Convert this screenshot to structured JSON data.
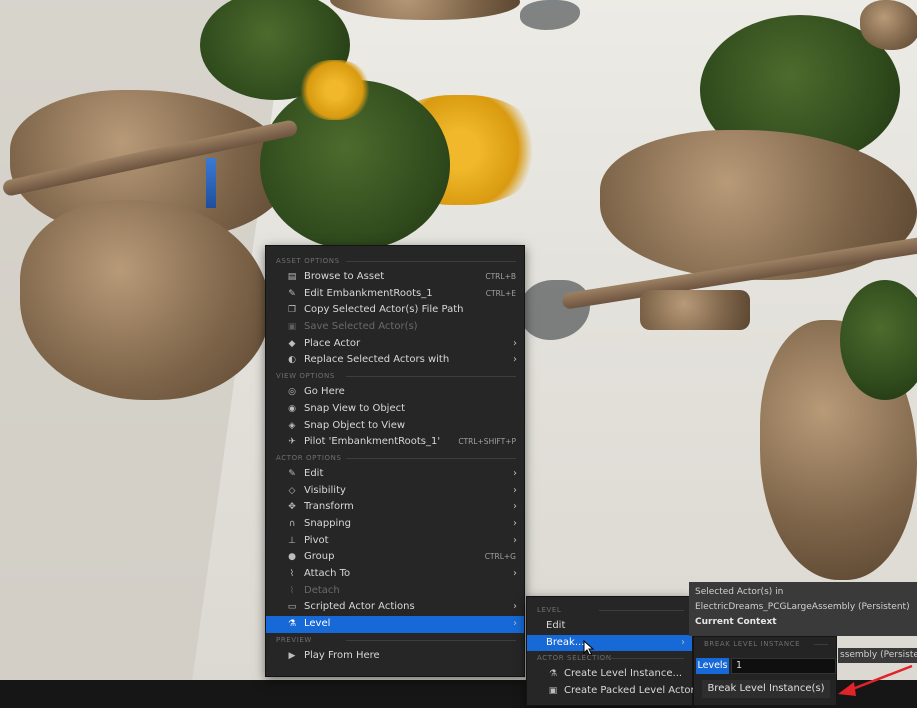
{
  "context_menu": {
    "sections": [
      {
        "header": "ASSET OPTIONS",
        "items": [
          {
            "label": "Browse to Asset",
            "shortcut": "CTRL+B",
            "icon": "folder-icon"
          },
          {
            "label": "Edit EmbankmentRoots_1",
            "shortcut": "CTRL+E",
            "icon": "edit-asset-icon"
          },
          {
            "label": "Copy Selected Actor(s) File Path",
            "icon": "copy-icon"
          },
          {
            "label": "Save Selected Actor(s)",
            "icon": "save-icon",
            "disabled": true
          },
          {
            "label": "Place Actor",
            "icon": "place-actor-icon",
            "submenu": true
          },
          {
            "label": "Replace Selected Actors with",
            "icon": "replace-icon",
            "submenu": true
          }
        ]
      },
      {
        "header": "VIEW OPTIONS",
        "items": [
          {
            "label": "Go Here",
            "icon": "go-here-icon"
          },
          {
            "label": "Snap View to Object",
            "icon": "snap-view-icon"
          },
          {
            "label": "Snap Object to View",
            "icon": "snap-object-icon"
          },
          {
            "label": "Pilot 'EmbankmentRoots_1'",
            "shortcut": "CTRL+SHIFT+P",
            "icon": "pilot-icon"
          }
        ]
      },
      {
        "header": "ACTOR OPTIONS",
        "items": [
          {
            "label": "Edit",
            "icon": "pencil-icon",
            "submenu": true
          },
          {
            "label": "Visibility",
            "icon": "eye-icon",
            "submenu": true
          },
          {
            "label": "Transform",
            "icon": "transform-icon",
            "submenu": true
          },
          {
            "label": "Snapping",
            "icon": "magnet-icon",
            "submenu": true
          },
          {
            "label": "Pivot",
            "icon": "pivot-icon",
            "submenu": true
          },
          {
            "label": "Group",
            "shortcut": "CTRL+G",
            "icon": "group-icon"
          },
          {
            "label": "Attach To",
            "icon": "attach-icon",
            "submenu": true
          },
          {
            "label": "Detach",
            "icon": "detach-icon",
            "disabled": true
          },
          {
            "label": "Scripted Actor Actions",
            "icon": "script-icon",
            "submenu": true
          },
          {
            "label": "Level",
            "icon": "level-icon",
            "submenu": true,
            "active": true
          }
        ]
      },
      {
        "header": "PREVIEW",
        "items": [
          {
            "label": "Play From Here",
            "icon": "play-icon"
          }
        ]
      }
    ]
  },
  "level_submenu": {
    "header": "LEVEL",
    "edit_label": "Edit",
    "break_label": "Break...",
    "actor_selection_header": "ACTOR SELECTION",
    "create_level_instance_label": "Create Level Instance...",
    "create_packed_label": "Create Packed Level Actor..."
  },
  "info_panel": {
    "line1": "Selected Actor(s) in",
    "line2": "ElectricDreams_PCGLargeAssembly (Persistent)",
    "line3": "Current Context",
    "tail": "ssembly (Persiste"
  },
  "break_panel": {
    "header": "BREAK LEVEL INSTANCE",
    "levels_label": "Levels",
    "levels_value": "1",
    "button_label": "Break Level Instance(s)"
  },
  "colors": {
    "menu_bg": "#262626",
    "highlight": "#1669d6",
    "annotation_arrow": "#e0242a"
  }
}
